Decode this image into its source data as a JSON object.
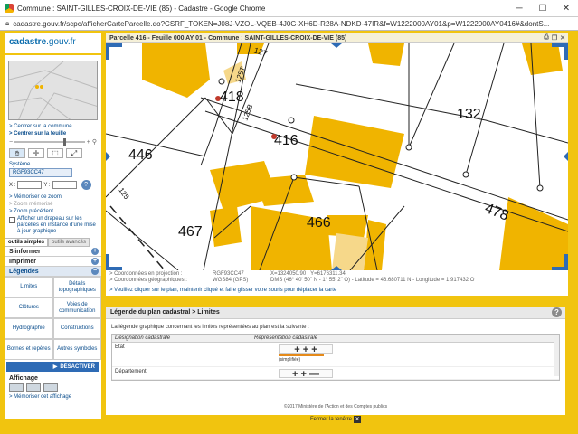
{
  "browser": {
    "title": "Commune : SAINT-GILLES-CROIX-DE-VIE (85) - Cadastre - Google Chrome",
    "url": "cadastre.gouv.fr/scpc/afficherCarteParcelle.do?CSRF_TOKEN=J08J-VZOL-VQEB-4J0G-XH6D-R28A-NDKD-47IR&f=W1222000AY01&p=W1222000AY0416#&dontS..."
  },
  "sidebar": {
    "logo_main": "cadastre",
    "logo_sub": ".gouv.fr",
    "center_commune": "> Centrer sur la commune",
    "center_feuille": "> Centrer sur la feuille",
    "systeme_label": "Système",
    "systeme_value": "RGF93CC47",
    "x_label": "X :",
    "y_label": "Y :",
    "go": "?",
    "memo_zoom": "> Mémoriser ce zoom",
    "zoom_memorise": "> Zoom mémorisé",
    "zoom_precedent": "> Zoom précédent",
    "drapeau": "Afficher un drapeau sur les parcelles en instance d'une mise à jour graphique",
    "tab_simple": "outils simples",
    "tab_avance": "outils avancés",
    "s_informer": "S'informer",
    "imprimer": "Imprimer",
    "legendes": "Légendes",
    "legend_items": [
      "Limites",
      "Détails topographiques",
      "Clôtures",
      "Voies de communication",
      "Hydrographie",
      "Constructions",
      "Bornes et repères",
      "Autres symboles"
    ],
    "desactiver": "DÉSACTIVER",
    "affichage": "Affichage",
    "memo_affichage": "> Mémoriser cet affichage"
  },
  "map_panel": {
    "title": "Parcelle 416 - Feuille 000 AY 01 - Commune : SAINT-GILLES-CROIX-DE-VIE (85)",
    "parcels": [
      "418",
      "416",
      "132",
      "446",
      "467",
      "466",
      "478",
      "127",
      "125T",
      "125B",
      "125"
    ],
    "coord_proj_label": "> Coordonnées en projection :",
    "coord_proj_sys": "RGF93CC47",
    "coord_proj_val": "X=1324050.90 ; Y=6176311.34",
    "coord_geo_label": "> Coordonnées géographiques :",
    "coord_geo_sys": "WGS84 (GPS)",
    "coord_geo_val": "DMS (46° 40' 50\" N - 1° 55' 2\" O) - Latitude = 46.680711 N - Longitude = 1.917432 O",
    "help": "> Veuillez cliquer sur le plan, maintenir cliqué et faire glisser votre souris pour déplacer la carte"
  },
  "legend": {
    "title": "Légende du plan cadastral > Limites",
    "intro": "La légende graphique concernant les limites représentées au plan est la suivante :",
    "col1": "Désignation cadastrale",
    "col2": "Représentation cadastrale",
    "row1_label": "Etat",
    "row1_symbol": "+ + +",
    "row1_note": "(simplifiée)",
    "row2_label": "Département",
    "row2_symbol": "+ + —"
  },
  "footer": {
    "copyright": "©2017 Ministère de l'Action et des Comptes publics",
    "close": "Fermer la fenêtre"
  }
}
